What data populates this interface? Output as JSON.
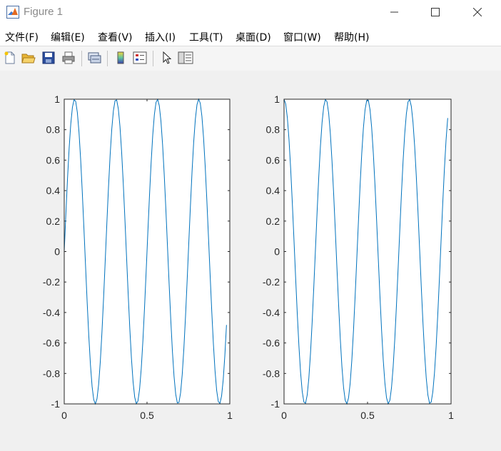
{
  "window": {
    "title": "Figure 1"
  },
  "menu": {
    "file": "文件(F)",
    "edit": "编辑(E)",
    "view": "查看(V)",
    "insert": "插入(I)",
    "tools": "工具(T)",
    "desktop": "桌面(D)",
    "window": "窗口(W)",
    "help": "帮助(H)"
  },
  "toolbar": {
    "buttons": [
      "new-figure-icon",
      "open-file-icon",
      "save-icon",
      "print-icon",
      "link-plot-icon",
      "insert-colorbar-icon",
      "insert-legend-icon",
      "edit-plot-icon",
      "property-inspector-icon"
    ]
  },
  "colors": {
    "line": "#0072bd",
    "axes_bg": "#ffffff",
    "figure_bg": "#f0f0f0"
  },
  "chart_data": [
    {
      "type": "line",
      "xlim": [
        0,
        1
      ],
      "ylim": [
        -1,
        1
      ],
      "xticks": [
        "0",
        "0.5",
        "1"
      ],
      "yticks": [
        "1",
        "0.8",
        "0.6",
        "0.4",
        "0.2",
        "0",
        "-0.2",
        "-0.4",
        "-0.6",
        "-0.8",
        "-1"
      ],
      "series": [
        {
          "function": "sin",
          "frequency": 4,
          "x_start": 0,
          "x_end": 0.98,
          "points": 100
        }
      ]
    },
    {
      "type": "line",
      "xlim": [
        0,
        1
      ],
      "ylim": [
        -1,
        1
      ],
      "xticks": [
        "0",
        "0.5",
        "1"
      ],
      "yticks": [
        "1",
        "0.8",
        "0.6",
        "0.4",
        "0.2",
        "0",
        "-0.2",
        "-0.4",
        "-0.6",
        "-0.8",
        "-1"
      ],
      "series": [
        {
          "function": "cos",
          "frequency": 4,
          "x_start": 0,
          "x_end": 0.98,
          "points": 100
        }
      ]
    }
  ]
}
